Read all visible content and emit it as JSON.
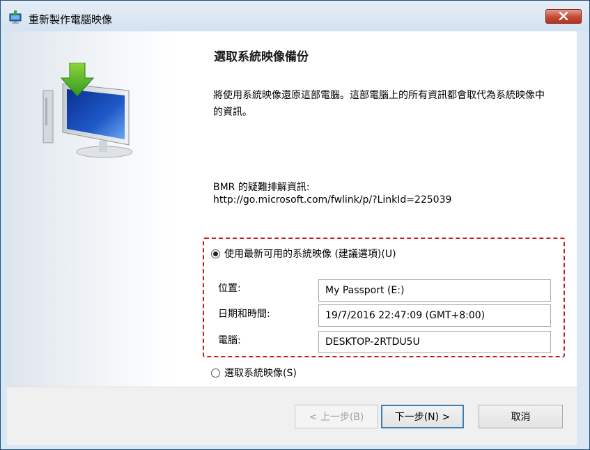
{
  "window": {
    "title": "重新製作電腦映像",
    "accent_color": "#c44a36",
    "icon": "restore-computer-icon"
  },
  "main": {
    "heading": "選取系統映像備份",
    "description": "將使用系統映像還原這部電腦。這部電腦上的所有資訊都會取代為系統映像中的資訊。",
    "bmr_label": "BMR 的疑難排解資訊:",
    "bmr_link": "http://go.microsoft.com/fwlink/p/?LinkId=225039",
    "graphic_icon": "monitor-restore-icon"
  },
  "options": {
    "latest_label": "使用最新可用的系統映像 (建議選項)(U)",
    "latest_selected": true,
    "choose_label": "選取系統映像(S)",
    "choose_selected": false
  },
  "fields": {
    "location_label": "位置:",
    "location_value": "My Passport (E:)",
    "datetime_label": "日期和時間:",
    "datetime_value": "19/7/2016 22:47:09 (GMT+8:00)",
    "computer_label": "電腦:",
    "computer_value": "DESKTOP-2RTDU5U"
  },
  "highlight_color": "#cc1a1a",
  "buttons": {
    "back": "< 上一步(B)",
    "next": "下一步(N) >",
    "cancel": "取消"
  }
}
